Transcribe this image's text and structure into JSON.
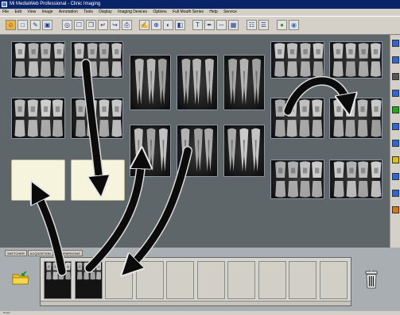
{
  "window": {
    "title": "Mi MediaWeb Professional - Clinic Imaging"
  },
  "menubar": {
    "items": [
      "File",
      "Edit",
      "View",
      "Image",
      "Annotation",
      "Tools",
      "Display",
      "Imaging Devices",
      "Options",
      "Full Mouth Series",
      "Help",
      "Service"
    ]
  },
  "toolbar": {
    "buttons": [
      {
        "name": "patient",
        "glyph": "☺"
      },
      {
        "name": "open",
        "glyph": "□"
      },
      {
        "name": "edit",
        "glyph": "✎"
      },
      {
        "name": "save",
        "glyph": "▣"
      },
      {
        "name": "capture",
        "glyph": "◎"
      },
      {
        "name": "new-image",
        "glyph": "☐"
      },
      {
        "name": "copy",
        "glyph": "❐"
      },
      {
        "name": "import",
        "glyph": "↵"
      },
      {
        "name": "export",
        "glyph": "↪"
      },
      {
        "name": "print",
        "glyph": "⎙"
      },
      {
        "name": "annotate",
        "glyph": "✍"
      },
      {
        "name": "zoom",
        "glyph": "⊕"
      },
      {
        "name": "enhance",
        "glyph": "◐"
      },
      {
        "name": "compare",
        "glyph": "◧"
      },
      {
        "name": "text",
        "glyph": "T"
      },
      {
        "name": "pen",
        "glyph": "✒"
      },
      {
        "name": "measure",
        "glyph": "─"
      },
      {
        "name": "layout",
        "glyph": "▦"
      },
      {
        "name": "template",
        "glyph": "☷"
      },
      {
        "name": "series",
        "glyph": "☰"
      },
      {
        "name": "globe",
        "glyph": "●"
      },
      {
        "name": "help",
        "glyph": "◉"
      }
    ]
  },
  "tray": {
    "tabs": [
      "SKETCHER",
      "ACQUISITION",
      "COMPARISONS"
    ],
    "filled_slots": 2,
    "empty_slots": 8
  },
  "statusbar": {
    "text": "Ready"
  },
  "colors": {
    "workspace": "#5f666a",
    "placeholder": "#f7f4de",
    "arrow": "#0b0b0b",
    "titlebar": "#0a246a"
  }
}
